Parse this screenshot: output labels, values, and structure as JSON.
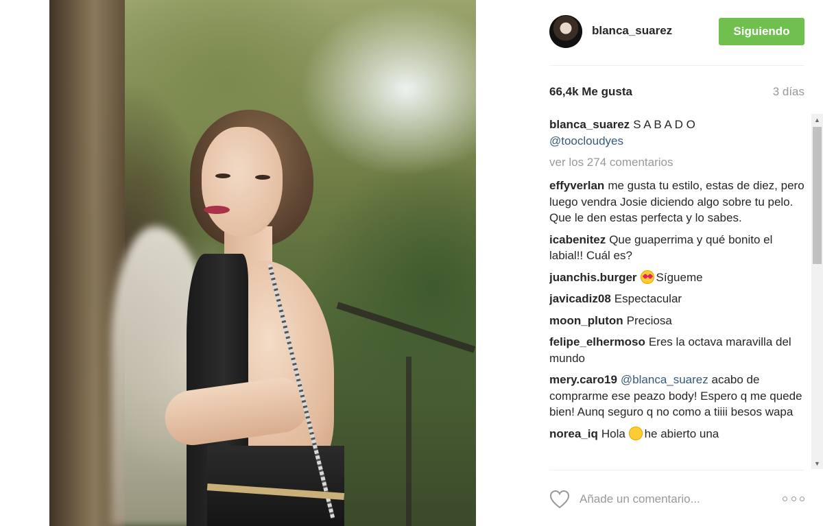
{
  "post": {
    "username": "blanca_suarez",
    "follow_label": "Siguiendo",
    "likes": "66,4k Me gusta",
    "time": "3 días",
    "caption_text": "S A B A D O",
    "caption_mention": "@toocloudyes",
    "view_all": "ver los 274 comentarios"
  },
  "comments": [
    {
      "user": "effyverlan",
      "text": "me gusta tu estilo, estas de diez, pero luego vendra Josie diciendo algo sobre tu pelo. Que le den estas perfecta y lo sabes."
    },
    {
      "user": "icabenitez",
      "text": "Que guaperrima y qué bonito el labial!! Cuál es?"
    },
    {
      "user": "juanchis.burger",
      "text": "Sígueme",
      "emoji": "heart-eyes-emoji"
    },
    {
      "user": "javicadiz08",
      "text": "Espectacular"
    },
    {
      "user": "moon_pluton",
      "text": "Preciosa"
    },
    {
      "user": "felipe_elhermoso",
      "text": "Eres la octava maravilla del mundo"
    },
    {
      "user": "mery.caro19",
      "mention": "@blanca_suarez",
      "text": "acabo de comprarme ese peazo body! Espero q me quede bien! Aunq seguro q no como a tiiii besos wapa"
    },
    {
      "user": "norea_iq",
      "text_before": "Hola",
      "emoji": "smile-emoji",
      "text": "he abierto una"
    }
  ],
  "footer": {
    "comment_placeholder": "Añade un comentario...",
    "like_icon": "heart-outline-icon",
    "more_icon": "more-options-icon"
  },
  "colors": {
    "follow_button": "#70c050",
    "mention": "#36597d",
    "muted": "#999999",
    "text": "#262626"
  }
}
